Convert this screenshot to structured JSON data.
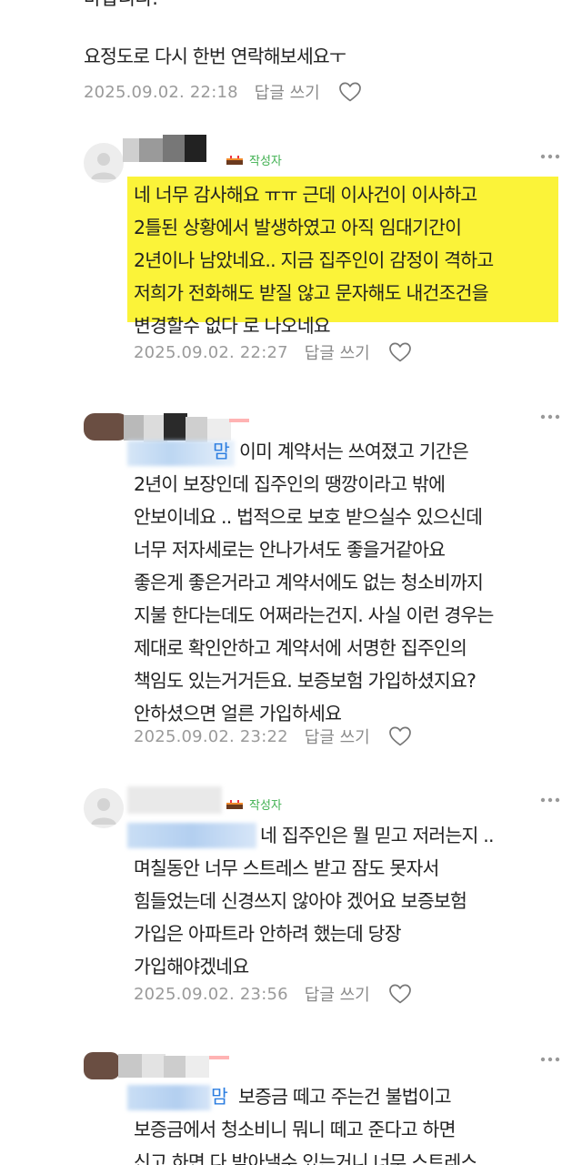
{
  "comments": [
    {
      "id": "c0",
      "lines": [
        "요정도로 다시 한번 연락해보세요ㅜ"
      ],
      "date": "2025.09.02. 22:18",
      "reply_label": "답글 쓰기"
    },
    {
      "id": "c1",
      "is_author": true,
      "author_badge": "작성자",
      "lines": [
        "네 너무 감사해요 ㅠㅠ 근데 이사건이 이사하고",
        "2틀된 상황에서 발생하였고 아직 임대기간이",
        "2년이나 남았네요.. 지금 집주인이 감정이 격하고",
        "저희가 전화해도 받질 않고 문자해도 내건조건을",
        "변경할수 없다 로 나오네요"
      ],
      "date": "2025.09.02. 22:27",
      "reply_label": "답글 쓰기"
    },
    {
      "id": "c2",
      "mention_visible": "맘",
      "lines": [
        "이미 계약서는 쓰여졌고 기간은",
        "2년이 보장인데 집주인의 땡깡이라고 밖에",
        "안보이네요 .. 법적으로 보호 받으실수 있으신데",
        "너무 저자세로는 안나가셔도 좋을거같아요",
        "좋은게 좋은거라고 계약서에도 없는 청소비까지",
        "지불 한다는데도 어쩌라는건지. 사실 이런 경우는",
        "제대로 확인안하고 계약서에 서명한 집주인의",
        "책임도 있는거거든요. 보증보험 가입하셨지요?",
        "안하셨으면 얼른 가입하세요"
      ],
      "date": "2025.09.02. 23:22",
      "reply_label": "답글 쓰기"
    },
    {
      "id": "c3",
      "is_author": true,
      "author_badge": "작성자",
      "lines": [
        "네 집주인은 뭘 믿고 저러는지 ..",
        "며칠동안 너무 스트레스 받고 잠도 못자서",
        "힘들었는데 신경쓰지 않아야 겠어요 보증보험",
        "가입은 아파트라 안하려 했는데 당장",
        "가입해야겠네요"
      ],
      "date": "2025.09.02. 23:56",
      "reply_label": "답글 쓰기"
    },
    {
      "id": "c4",
      "mention_visible": "맘",
      "lines": [
        "보증금 떼고 주는건 불법이고",
        "보증금에서 청소비니 뭐니 떼고 준다고 하면",
        "신고 하면 다 받아낼수 있는거니 너무 스트레스"
      ]
    }
  ],
  "colors": {
    "highlight": "#fbf339",
    "author_badge": "#3fb050",
    "mention": "#2b7de0",
    "meta": "#9a9a9a"
  },
  "icons": {
    "more": "more-vertical-dots-icon",
    "like": "heart-outline-icon",
    "avatar": "default-avatar-icon",
    "badge": "author-cake-icon"
  }
}
